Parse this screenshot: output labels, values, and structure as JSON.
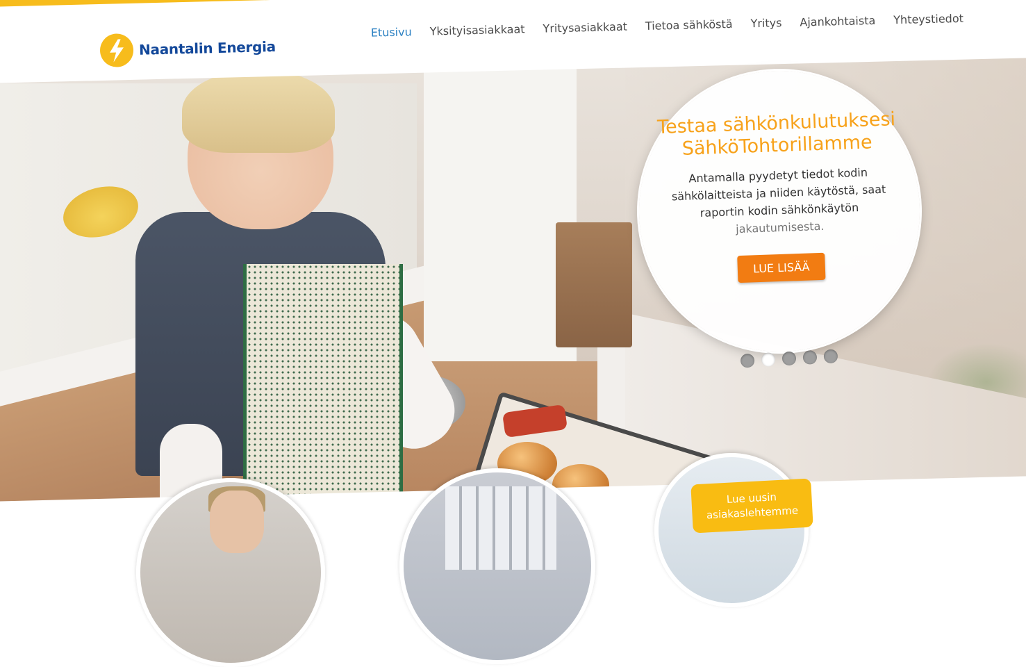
{
  "brand": {
    "name": "Naantalin Energia",
    "color": "#13489a",
    "accent": "#f7bc1c",
    "icon": "lightning-bolt-icon"
  },
  "nav": {
    "items": [
      {
        "label": "Etusivu",
        "active": true
      },
      {
        "label": "Yksityisasiakkaat"
      },
      {
        "label": "Yritysasiakkaat"
      },
      {
        "label": "Tietoa sähköstä"
      },
      {
        "label": "Yritys"
      },
      {
        "label": "Ajankohtaista"
      },
      {
        "label": "Yhteystiedot"
      }
    ]
  },
  "hero": {
    "title": "Testaa sähkönkulutuksesi SähköTohtorillamme",
    "text_main": "Antamalla pyydetyt tiedot kodin sähkölaitteista ja niiden käytöstä, saat raportin kodin sähkönkäytön",
    "text_faded": "jakautumisesta.",
    "button_label": "LUE LISÄÄ",
    "button_color": "#f27c12",
    "slides": 5,
    "active_slide": 2
  },
  "promo": {
    "magazine_label": "Lue uusin asiakaslehtemme",
    "magazine_color": "#f9bc12"
  }
}
